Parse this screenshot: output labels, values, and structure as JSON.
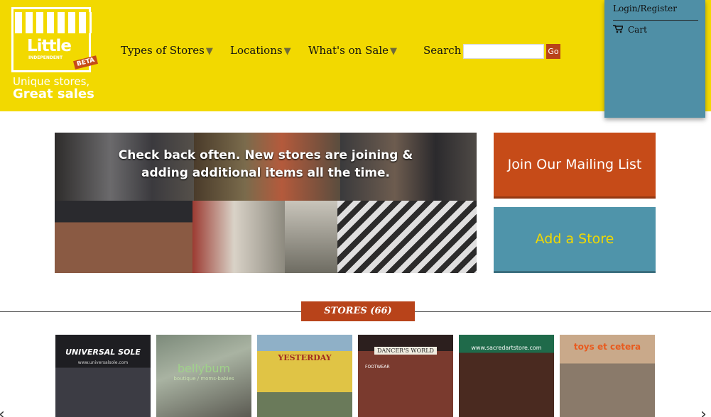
{
  "logo": {
    "word": "Little",
    "subword": "INDEPENDENT",
    "badge": "BETA",
    "tagline_1": "Unique stores,",
    "tagline_2": "Great sales"
  },
  "nav": {
    "items": [
      {
        "label": "Types of Stores",
        "caret": "▼"
      },
      {
        "label": "Locations",
        "caret": "▼"
      },
      {
        "label": "What's on Sale",
        "caret": "▼"
      }
    ],
    "search_label": "Search",
    "search_value": "",
    "go_label": "Go"
  },
  "account": {
    "login_label": "Login/Register",
    "cart_label": "Cart",
    "cart_icon": "cart-icon"
  },
  "hero": {
    "line_1": "Check back often. New stores are joining &",
    "line_2": "adding additional items all the time."
  },
  "cta": {
    "join_label": "Join Our Mailing List",
    "add_label": "Add a Store"
  },
  "stores": {
    "heading": "STORES (66)",
    "thumbs": [
      {
        "sign": "UNIVERSAL SOLE",
        "sub": "www.universalsole.com"
      },
      {
        "sign": "bellybum",
        "sub": "boutique / moms-babies"
      },
      {
        "sign": "YESTERDAY",
        "sub": ""
      },
      {
        "sign": "DANCER'S WORLD",
        "sub": "FOOTWEAR"
      },
      {
        "sign": "www.sacredartstore.com",
        "sub": ""
      },
      {
        "sign": "toys et cetera",
        "sub": ""
      }
    ]
  },
  "colors": {
    "header_yellow": "#f2d900",
    "accent_orange": "#c64b18",
    "panel_blue": "#4f8fa6",
    "add_store_text": "#f2d900"
  }
}
